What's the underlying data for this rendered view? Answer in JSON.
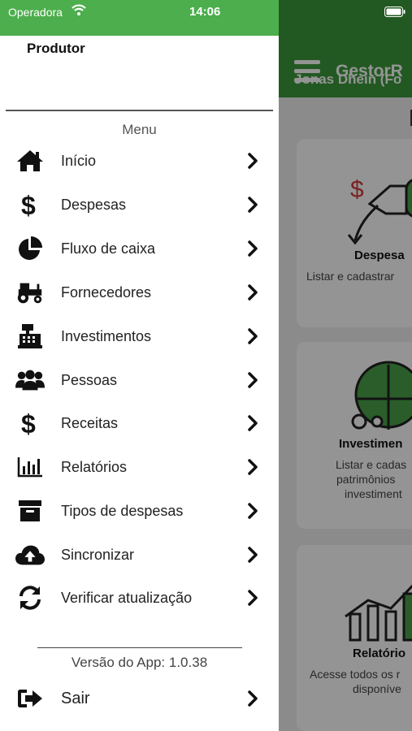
{
  "status_bar": {
    "carrier": "Operadora",
    "time": "14:06"
  },
  "background": {
    "app_title": "GestorR",
    "user_name": "Jonas Dhein (Fo",
    "cards": [
      {
        "title": "Despesa",
        "description": "Listar e cadastrar"
      },
      {
        "title": "Investimen",
        "description_lines": [
          "Listar e cadas",
          "patrimônios",
          "investiment"
        ]
      },
      {
        "title": "Relatório",
        "description_lines": [
          "Acesse todos os r",
          "disponíve"
        ]
      }
    ]
  },
  "drawer": {
    "profile_name": "Produtor",
    "menu_title": "Menu",
    "items": [
      {
        "label": "Início",
        "icon": "home-icon"
      },
      {
        "label": "Despesas",
        "icon": "dollar-icon"
      },
      {
        "label": "Fluxo de caixa",
        "icon": "pie-chart-icon"
      },
      {
        "label": "Fornecedores",
        "icon": "tractor-icon"
      },
      {
        "label": "Investimentos",
        "icon": "cash-register-icon"
      },
      {
        "label": "Pessoas",
        "icon": "people-icon"
      },
      {
        "label": "Receitas",
        "icon": "dollar-icon"
      },
      {
        "label": "Relatórios",
        "icon": "bar-chart-icon"
      },
      {
        "label": "Tipos de despesas",
        "icon": "archive-box-icon"
      },
      {
        "label": "Sincronizar",
        "icon": "cloud-upload-icon"
      },
      {
        "label": "Verificar atualização",
        "icon": "sync-icon"
      }
    ],
    "version": "Versão do App: 1.0.38",
    "logout_label": "Sair"
  }
}
